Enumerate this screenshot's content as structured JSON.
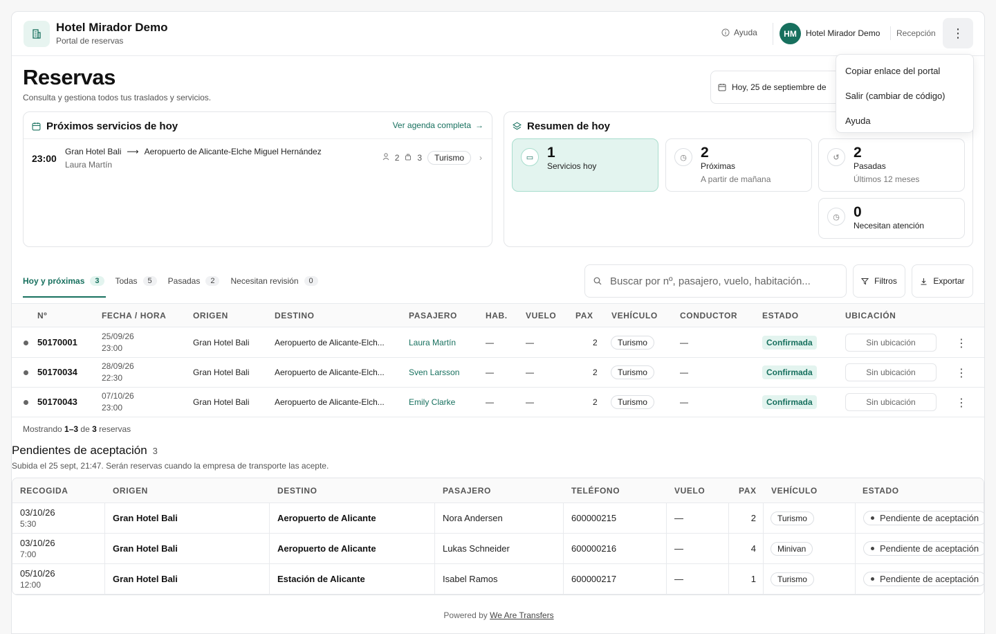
{
  "header": {
    "title": "Hotel Mirador Demo",
    "subtitle": "Portal de reservas",
    "help": "Ayuda",
    "avatar_initials": "HM",
    "user_name": "Hotel Mirador Demo",
    "user_role": "Recepción",
    "menu_icon": "⋮"
  },
  "menu": {
    "items": [
      "Copiar enlace del portal",
      "Salir (cambiar de código)",
      "Ayuda"
    ]
  },
  "page": {
    "title": "Reservas",
    "subtitle": "Consulta y gestiona todos tus traslados y servicios.",
    "date": "Hoy, 25 de septiembre de"
  },
  "upcoming": {
    "title": "Próximos servicios de hoy",
    "link": "Ver agenda completa",
    "service": {
      "time": "23:00",
      "origin": "Gran Hotel Bali",
      "arrow": "⟶",
      "destination": "Aeropuerto de Alicante-Elche Miguel Hernández",
      "passenger": "Laura Martín",
      "pax": "2",
      "luggage": "3",
      "vehicle": "Turismo"
    }
  },
  "summary": {
    "title": "Resumen de hoy",
    "stats": [
      {
        "num": "1",
        "label": "Servicios hoy",
        "sub": ""
      },
      {
        "num": "2",
        "label": "Próximas",
        "sub": "A partir de mañana"
      },
      {
        "num": "2",
        "label": "Pasadas",
        "sub": "Últimos 12 meses"
      },
      {
        "num": "0",
        "label": "Necesitan atención",
        "sub": ""
      }
    ]
  },
  "tabs": [
    {
      "label": "Hoy y próximas",
      "count": "3"
    },
    {
      "label": "Todas",
      "count": "5"
    },
    {
      "label": "Pasadas",
      "count": "2"
    },
    {
      "label": "Necesitan revisión",
      "count": "0"
    }
  ],
  "search": {
    "placeholder": "Buscar por nº, pasajero, vuelo, habitación..."
  },
  "buttons": {
    "filters": "Filtros",
    "export": "Exportar"
  },
  "table": {
    "headers": [
      "Nº",
      "FECHA / HORA",
      "ORIGEN",
      "DESTINO",
      "PASAJERO",
      "HAB.",
      "VUELO",
      "PAX",
      "VEHÍCULO",
      "CONDUCTOR",
      "ESTADO",
      "UBICACIÓN"
    ],
    "rows": [
      {
        "id": "50170001",
        "date": "25/09/26",
        "time": "23:00",
        "origin": "Gran Hotel Bali",
        "destination": "Aeropuerto de Alicante-Elch...",
        "passenger": "Laura Martín",
        "room": "—",
        "flight": "—",
        "pax": "2",
        "vehicle": "Turismo",
        "driver": "—",
        "status": "Confirmada",
        "location": "Sin ubicación"
      },
      {
        "id": "50170034",
        "date": "28/09/26",
        "time": "22:30",
        "origin": "Gran Hotel Bali",
        "destination": "Aeropuerto de Alicante-Elch...",
        "passenger": "Sven Larsson",
        "room": "—",
        "flight": "—",
        "pax": "2",
        "vehicle": "Turismo",
        "driver": "—",
        "status": "Confirmada",
        "location": "Sin ubicación"
      },
      {
        "id": "50170043",
        "date": "07/10/26",
        "time": "23:00",
        "origin": "Gran Hotel Bali",
        "destination": "Aeropuerto de Alicante-Elch...",
        "passenger": "Emily Clarke",
        "room": "—",
        "flight": "—",
        "pax": "2",
        "vehicle": "Turismo",
        "driver": "—",
        "status": "Confirmada",
        "location": "Sin ubicación"
      }
    ],
    "showing_prefix": "Mostrando",
    "showing_range": "1–3",
    "showing_mid": "de",
    "showing_total": "3",
    "showing_suffix": "reservas"
  },
  "pending": {
    "title": "Pendientes de aceptación",
    "count": "3",
    "subtitle": "Subida el 25 sept, 21:47. Serán reservas cuando la empresa de transporte las acepte.",
    "headers": [
      "RECOGIDA",
      "ORIGEN",
      "DESTINO",
      "PASAJERO",
      "TELÉFONO",
      "VUELO",
      "PAX",
      "VEHÍCULO",
      "ESTADO"
    ],
    "rows": [
      {
        "date": "03/10/26",
        "time": "5:30",
        "origin": "Gran Hotel Bali",
        "destination": "Aeropuerto de Alicante",
        "passenger": "Nora Andersen",
        "phone": "600000215",
        "flight": "—",
        "pax": "2",
        "vehicle": "Turismo",
        "status": "Pendiente de aceptación"
      },
      {
        "date": "03/10/26",
        "time": "7:00",
        "origin": "Gran Hotel Bali",
        "destination": "Aeropuerto de Alicante",
        "passenger": "Lukas Schneider",
        "phone": "600000216",
        "flight": "—",
        "pax": "4",
        "vehicle": "Minivan",
        "status": "Pendiente de aceptación"
      },
      {
        "date": "05/10/26",
        "time": "12:00",
        "origin": "Gran Hotel Bali",
        "destination": "Estación de Alicante",
        "passenger": "Isabel Ramos",
        "phone": "600000217",
        "flight": "—",
        "pax": "1",
        "vehicle": "Turismo",
        "status": "Pendiente de aceptación"
      }
    ]
  },
  "footer": {
    "prefix": "Powered by",
    "link": "We Are Transfers"
  },
  "colors": {
    "accent": "#17705e",
    "accent_bg": "#e3f4ef"
  }
}
